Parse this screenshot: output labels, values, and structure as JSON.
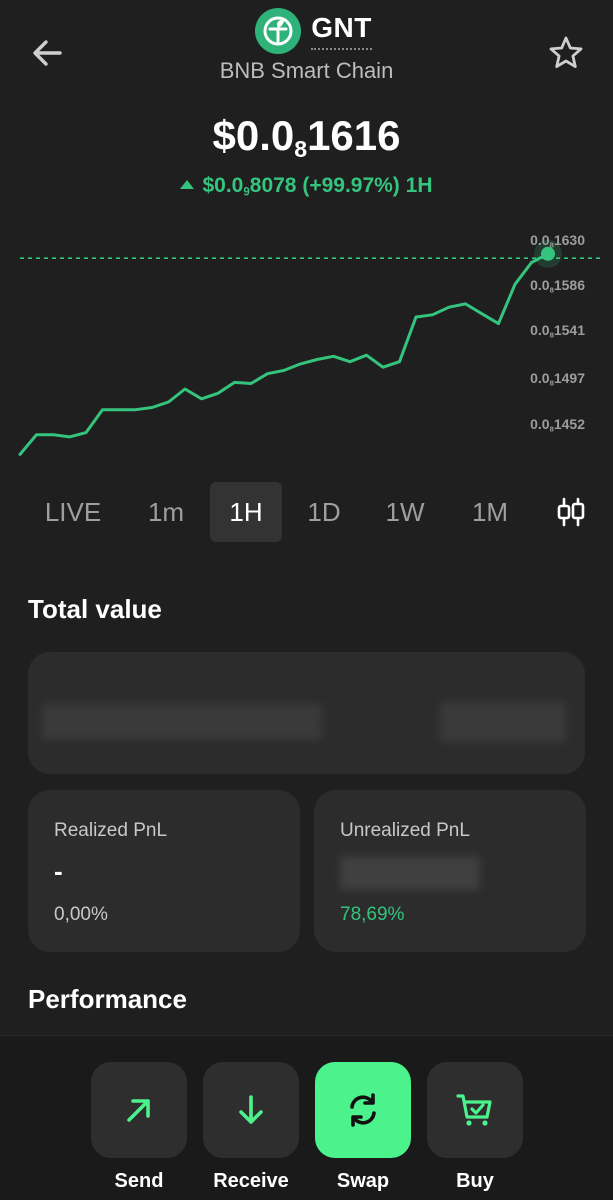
{
  "header": {
    "token_symbol": "GNT",
    "chain_name": "BNB Smart Chain",
    "back_icon": "arrow-left-icon",
    "favorite_icon": "star-icon"
  },
  "price": {
    "prefix": "$0.0",
    "sub": "8",
    "digits": "1616"
  },
  "change": {
    "prefix": "$0.0",
    "sub": "9",
    "digits": "8078",
    "pct": "(+99.97%)",
    "period": "1H",
    "color": "#35c47e"
  },
  "chart_data": {
    "type": "line",
    "y_ticks": [
      {
        "prefix": "0.0",
        "sub": "8",
        "digits": "1630"
      },
      {
        "prefix": "0.0",
        "sub": "8",
        "digits": "1586"
      },
      {
        "prefix": "0.0",
        "sub": "8",
        "digits": "1541"
      },
      {
        "prefix": "0.0",
        "sub": "8",
        "digits": "1497"
      },
      {
        "prefix": "0.0",
        "sub": "8",
        "digits": "1452"
      }
    ],
    "ylim": [
      1440,
      1640
    ],
    "values": [
      1436,
      1454,
      1454,
      1452,
      1456,
      1477,
      1477,
      1477,
      1479,
      1484,
      1496,
      1487,
      1492,
      1502,
      1501,
      1510,
      1513,
      1519,
      1523,
      1526,
      1521,
      1527,
      1516,
      1521,
      1562,
      1564,
      1571,
      1574,
      1565,
      1556,
      1592,
      1612,
      1620
    ],
    "last_value": 1616,
    "current_line": true,
    "line_color": "#35c47e"
  },
  "timeframes": [
    "LIVE",
    "1m",
    "1H",
    "1D",
    "1W",
    "1M"
  ],
  "active_timeframe": "1H",
  "candle_icon": "candlestick-icon",
  "total_value": {
    "title": "Total value"
  },
  "realized": {
    "label": "Realized PnL",
    "value": "-",
    "pct": "0,00%"
  },
  "unrealized": {
    "label": "Unrealized PnL",
    "pct": "78,69%"
  },
  "performance": {
    "title": "Performance"
  },
  "actions": [
    {
      "label": "Send",
      "icon": "arrow-up-right-icon"
    },
    {
      "label": "Receive",
      "icon": "arrow-down-icon"
    },
    {
      "label": "Swap",
      "icon": "swap-icon"
    },
    {
      "label": "Buy",
      "icon": "cart-icon"
    }
  ]
}
